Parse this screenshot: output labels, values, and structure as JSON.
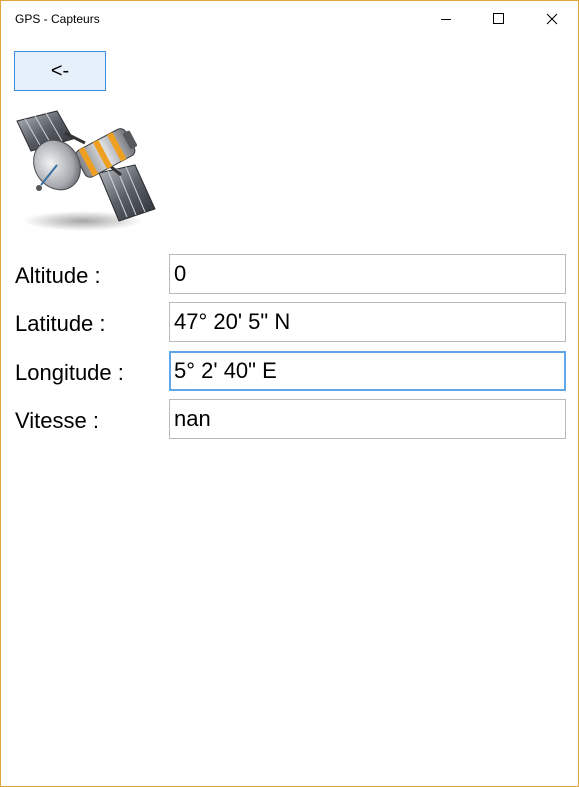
{
  "window": {
    "title": "GPS - Capteurs",
    "accent_color": "#e3a53a"
  },
  "toolbar": {
    "back_label": "<-"
  },
  "image": {
    "icon": "satellite-icon"
  },
  "fields": {
    "altitude": {
      "label": "Altitude :",
      "value": "0"
    },
    "latitude": {
      "label": "Latitude :",
      "value": "47° 20' 5\" N"
    },
    "longitude": {
      "label": "Longitude :",
      "value": "5° 2' 40\" E"
    },
    "vitesse": {
      "label": "Vitesse :",
      "value": "nan"
    }
  },
  "focused_field": "longitude",
  "focus_color": "#5fa7e8"
}
